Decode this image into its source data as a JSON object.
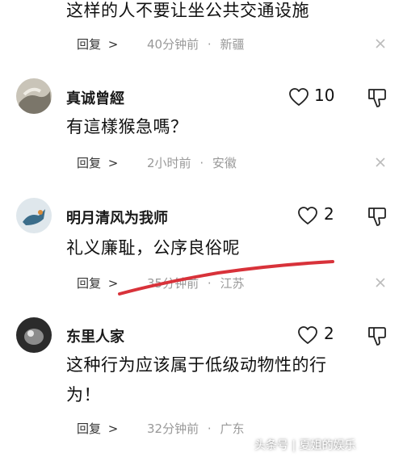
{
  "comments": [
    {
      "text": "这样的人不要让坐公共交通设施",
      "reply_label": "回复",
      "time": "40分钟前",
      "location": "新疆"
    },
    {
      "username": "真诚曾經",
      "likes": "10",
      "text": "有這樣猴急嗎？",
      "reply_label": "回复",
      "time": "2小时前",
      "location": "安徽"
    },
    {
      "username": "明月清风为我师",
      "likes": "2",
      "text": "礼义廉耻，公序良俗呢",
      "reply_label": "回复",
      "time": "35分钟前",
      "location": "江苏"
    },
    {
      "username": "东里人家",
      "likes": "2",
      "text_line1": "这种行为应该属于低级动物性的行",
      "text_line2": "为！",
      "reply_label": "回复",
      "time": "32分钟前",
      "location": "广东"
    }
  ],
  "separator": "·",
  "reply_arrow": ">",
  "watermark": "头条号 | 夏姐的娱乐",
  "colors": {
    "annotation_stroke": "#d8323a",
    "meta_gray": "#999999"
  }
}
